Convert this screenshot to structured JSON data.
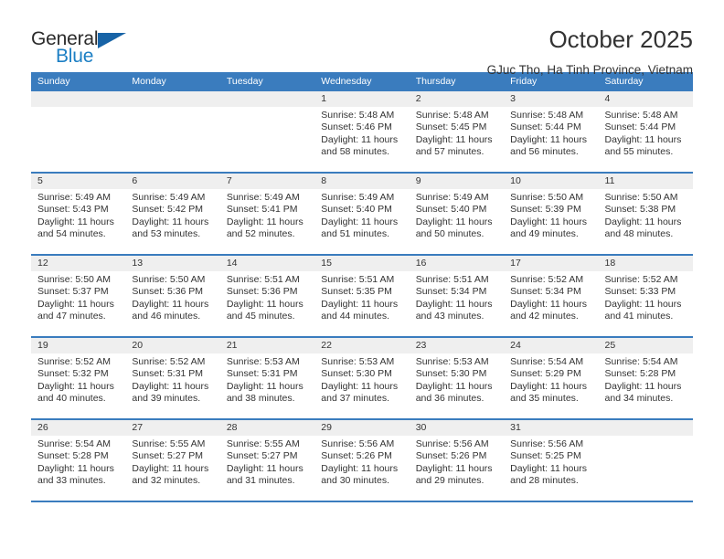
{
  "brand": {
    "name_top": "General",
    "name_bottom": "Blue",
    "flag_icon": "triangle-flag-icon",
    "color_top": "#2b2b2b",
    "color_bottom": "#1c7fc4",
    "flag_color": "#1763a6"
  },
  "header": {
    "title": "October 2025",
    "subtitle": "GJuc Tho, Ha Tinh Province, Vietnam"
  },
  "theme": {
    "header_band": "#3a7cbe",
    "daynum_band": "#efefef",
    "text": "#333333"
  },
  "calendar": {
    "weekdays": [
      "Sunday",
      "Monday",
      "Tuesday",
      "Wednesday",
      "Thursday",
      "Friday",
      "Saturday"
    ],
    "weeks": [
      [
        {
          "day": "",
          "lines": []
        },
        {
          "day": "",
          "lines": []
        },
        {
          "day": "",
          "lines": []
        },
        {
          "day": "1",
          "lines": [
            "Sunrise: 5:48 AM",
            "Sunset: 5:46 PM",
            "Daylight: 11 hours",
            "and 58 minutes."
          ]
        },
        {
          "day": "2",
          "lines": [
            "Sunrise: 5:48 AM",
            "Sunset: 5:45 PM",
            "Daylight: 11 hours",
            "and 57 minutes."
          ]
        },
        {
          "day": "3",
          "lines": [
            "Sunrise: 5:48 AM",
            "Sunset: 5:44 PM",
            "Daylight: 11 hours",
            "and 56 minutes."
          ]
        },
        {
          "day": "4",
          "lines": [
            "Sunrise: 5:48 AM",
            "Sunset: 5:44 PM",
            "Daylight: 11 hours",
            "and 55 minutes."
          ]
        }
      ],
      [
        {
          "day": "5",
          "lines": [
            "Sunrise: 5:49 AM",
            "Sunset: 5:43 PM",
            "Daylight: 11 hours",
            "and 54 minutes."
          ]
        },
        {
          "day": "6",
          "lines": [
            "Sunrise: 5:49 AM",
            "Sunset: 5:42 PM",
            "Daylight: 11 hours",
            "and 53 minutes."
          ]
        },
        {
          "day": "7",
          "lines": [
            "Sunrise: 5:49 AM",
            "Sunset: 5:41 PM",
            "Daylight: 11 hours",
            "and 52 minutes."
          ]
        },
        {
          "day": "8",
          "lines": [
            "Sunrise: 5:49 AM",
            "Sunset: 5:40 PM",
            "Daylight: 11 hours",
            "and 51 minutes."
          ]
        },
        {
          "day": "9",
          "lines": [
            "Sunrise: 5:49 AM",
            "Sunset: 5:40 PM",
            "Daylight: 11 hours",
            "and 50 minutes."
          ]
        },
        {
          "day": "10",
          "lines": [
            "Sunrise: 5:50 AM",
            "Sunset: 5:39 PM",
            "Daylight: 11 hours",
            "and 49 minutes."
          ]
        },
        {
          "day": "11",
          "lines": [
            "Sunrise: 5:50 AM",
            "Sunset: 5:38 PM",
            "Daylight: 11 hours",
            "and 48 minutes."
          ]
        }
      ],
      [
        {
          "day": "12",
          "lines": [
            "Sunrise: 5:50 AM",
            "Sunset: 5:37 PM",
            "Daylight: 11 hours",
            "and 47 minutes."
          ]
        },
        {
          "day": "13",
          "lines": [
            "Sunrise: 5:50 AM",
            "Sunset: 5:36 PM",
            "Daylight: 11 hours",
            "and 46 minutes."
          ]
        },
        {
          "day": "14",
          "lines": [
            "Sunrise: 5:51 AM",
            "Sunset: 5:36 PM",
            "Daylight: 11 hours",
            "and 45 minutes."
          ]
        },
        {
          "day": "15",
          "lines": [
            "Sunrise: 5:51 AM",
            "Sunset: 5:35 PM",
            "Daylight: 11 hours",
            "and 44 minutes."
          ]
        },
        {
          "day": "16",
          "lines": [
            "Sunrise: 5:51 AM",
            "Sunset: 5:34 PM",
            "Daylight: 11 hours",
            "and 43 minutes."
          ]
        },
        {
          "day": "17",
          "lines": [
            "Sunrise: 5:52 AM",
            "Sunset: 5:34 PM",
            "Daylight: 11 hours",
            "and 42 minutes."
          ]
        },
        {
          "day": "18",
          "lines": [
            "Sunrise: 5:52 AM",
            "Sunset: 5:33 PM",
            "Daylight: 11 hours",
            "and 41 minutes."
          ]
        }
      ],
      [
        {
          "day": "19",
          "lines": [
            "Sunrise: 5:52 AM",
            "Sunset: 5:32 PM",
            "Daylight: 11 hours",
            "and 40 minutes."
          ]
        },
        {
          "day": "20",
          "lines": [
            "Sunrise: 5:52 AM",
            "Sunset: 5:31 PM",
            "Daylight: 11 hours",
            "and 39 minutes."
          ]
        },
        {
          "day": "21",
          "lines": [
            "Sunrise: 5:53 AM",
            "Sunset: 5:31 PM",
            "Daylight: 11 hours",
            "and 38 minutes."
          ]
        },
        {
          "day": "22",
          "lines": [
            "Sunrise: 5:53 AM",
            "Sunset: 5:30 PM",
            "Daylight: 11 hours",
            "and 37 minutes."
          ]
        },
        {
          "day": "23",
          "lines": [
            "Sunrise: 5:53 AM",
            "Sunset: 5:30 PM",
            "Daylight: 11 hours",
            "and 36 minutes."
          ]
        },
        {
          "day": "24",
          "lines": [
            "Sunrise: 5:54 AM",
            "Sunset: 5:29 PM",
            "Daylight: 11 hours",
            "and 35 minutes."
          ]
        },
        {
          "day": "25",
          "lines": [
            "Sunrise: 5:54 AM",
            "Sunset: 5:28 PM",
            "Daylight: 11 hours",
            "and 34 minutes."
          ]
        }
      ],
      [
        {
          "day": "26",
          "lines": [
            "Sunrise: 5:54 AM",
            "Sunset: 5:28 PM",
            "Daylight: 11 hours",
            "and 33 minutes."
          ]
        },
        {
          "day": "27",
          "lines": [
            "Sunrise: 5:55 AM",
            "Sunset: 5:27 PM",
            "Daylight: 11 hours",
            "and 32 minutes."
          ]
        },
        {
          "day": "28",
          "lines": [
            "Sunrise: 5:55 AM",
            "Sunset: 5:27 PM",
            "Daylight: 11 hours",
            "and 31 minutes."
          ]
        },
        {
          "day": "29",
          "lines": [
            "Sunrise: 5:56 AM",
            "Sunset: 5:26 PM",
            "Daylight: 11 hours",
            "and 30 minutes."
          ]
        },
        {
          "day": "30",
          "lines": [
            "Sunrise: 5:56 AM",
            "Sunset: 5:26 PM",
            "Daylight: 11 hours",
            "and 29 minutes."
          ]
        },
        {
          "day": "31",
          "lines": [
            "Sunrise: 5:56 AM",
            "Sunset: 5:25 PM",
            "Daylight: 11 hours",
            "and 28 minutes."
          ]
        },
        {
          "day": "",
          "lines": []
        }
      ]
    ]
  }
}
